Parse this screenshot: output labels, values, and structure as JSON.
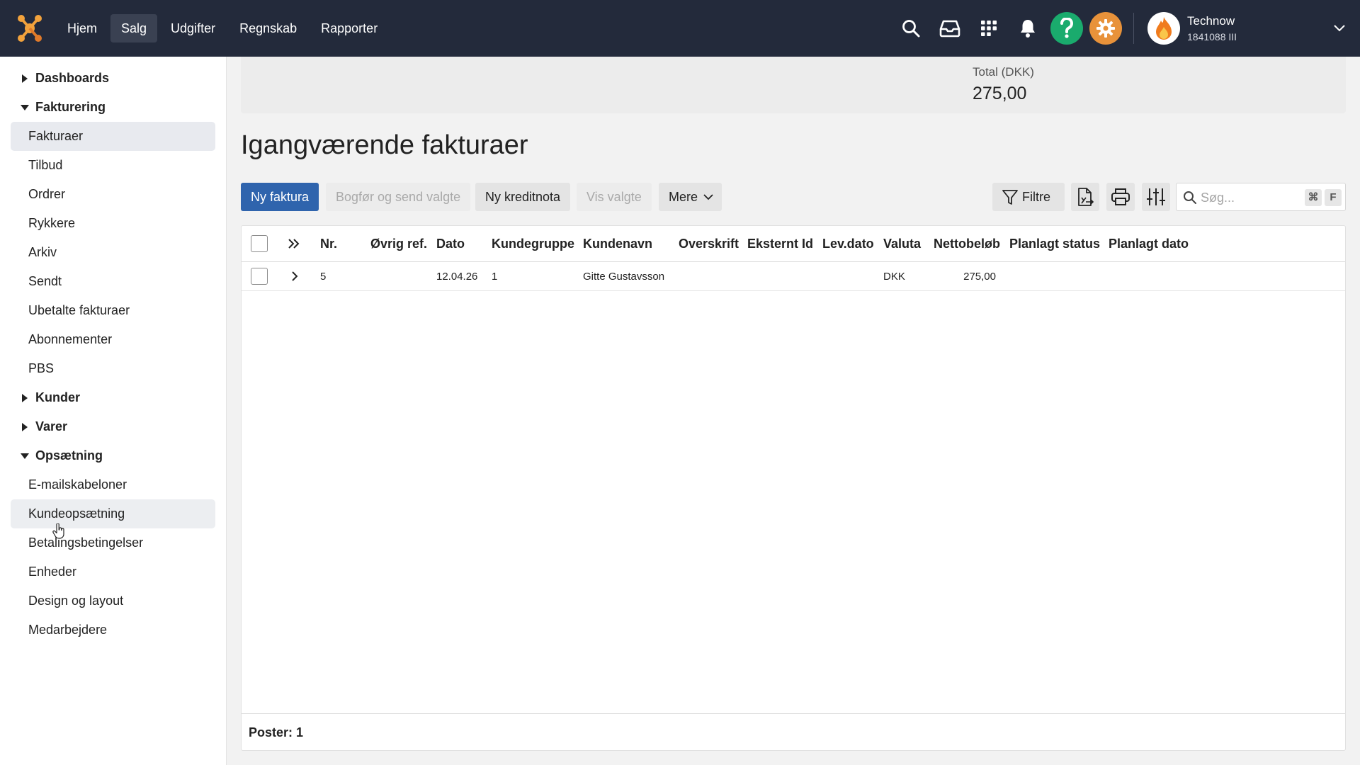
{
  "topbar": {
    "nav": [
      "Hjem",
      "Salg",
      "Udgifter",
      "Regnskab",
      "Rapporter"
    ],
    "active_nav": "Salg",
    "icons": [
      "search-icon",
      "inbox-icon",
      "apps-grid-icon",
      "bell-icon",
      "help-icon",
      "gear-icon"
    ],
    "user": {
      "name": "Technow",
      "id": "1841088 III"
    },
    "colors": {
      "bar": "#232a3b",
      "help": "#1aab6d",
      "settings": "#e8923a"
    }
  },
  "sidebar": {
    "groups": [
      {
        "label": "Dashboards",
        "expanded": false,
        "items": []
      },
      {
        "label": "Fakturering",
        "expanded": true,
        "items": [
          "Fakturaer",
          "Tilbud",
          "Ordrer",
          "Rykkere",
          "Arkiv",
          "Sendt",
          "Ubetalte fakturaer",
          "Abonnementer",
          "PBS"
        ]
      },
      {
        "label": "Kunder",
        "expanded": false,
        "items": []
      },
      {
        "label": "Varer",
        "expanded": false,
        "items": []
      },
      {
        "label": "Opsætning",
        "expanded": true,
        "items": [
          "E-mailskabeloner",
          "Kundeopsætning",
          "Betalingsbetingelser",
          "Enheder",
          "Design og layout",
          "Medarbejdere"
        ]
      }
    ],
    "active_item": "Fakturaer",
    "hover_item": "Kundeopsætning"
  },
  "summary": {
    "label": "Total (DKK)",
    "value": "275,00"
  },
  "page": {
    "title": "Igangværende fakturaer"
  },
  "toolbar": {
    "new_invoice": "Ny faktura",
    "book_send": "Bogfør og send valgte",
    "new_credit": "Ny kreditnota",
    "show_selected": "Vis valgte",
    "more": "Mere",
    "filters": "Filtre",
    "search_placeholder": "Søg...",
    "shortcut_cmd": "⌘",
    "shortcut_key": "F",
    "primary_color": "#2f64ad"
  },
  "table": {
    "columns": [
      "Nr.",
      "Øvrig ref.",
      "Dato",
      "Kundegruppe",
      "Kundenavn",
      "Overskrift",
      "Eksternt Id",
      "Lev.dato",
      "Valuta",
      "Nettobeløb",
      "Planlagt status",
      "Planlagt dato"
    ],
    "rows": [
      {
        "nr": "5",
        "ref": "",
        "dato": "12.04.26",
        "kundegruppe": "1",
        "kundenavn": "Gitte Gustavsson",
        "overskrift": "",
        "eksternt_id": "",
        "lev_dato": "",
        "valuta": "DKK",
        "nettobelob": "275,00",
        "planlagt_status": "",
        "planlagt_dato": ""
      }
    ],
    "footer": "Poster: 1"
  }
}
